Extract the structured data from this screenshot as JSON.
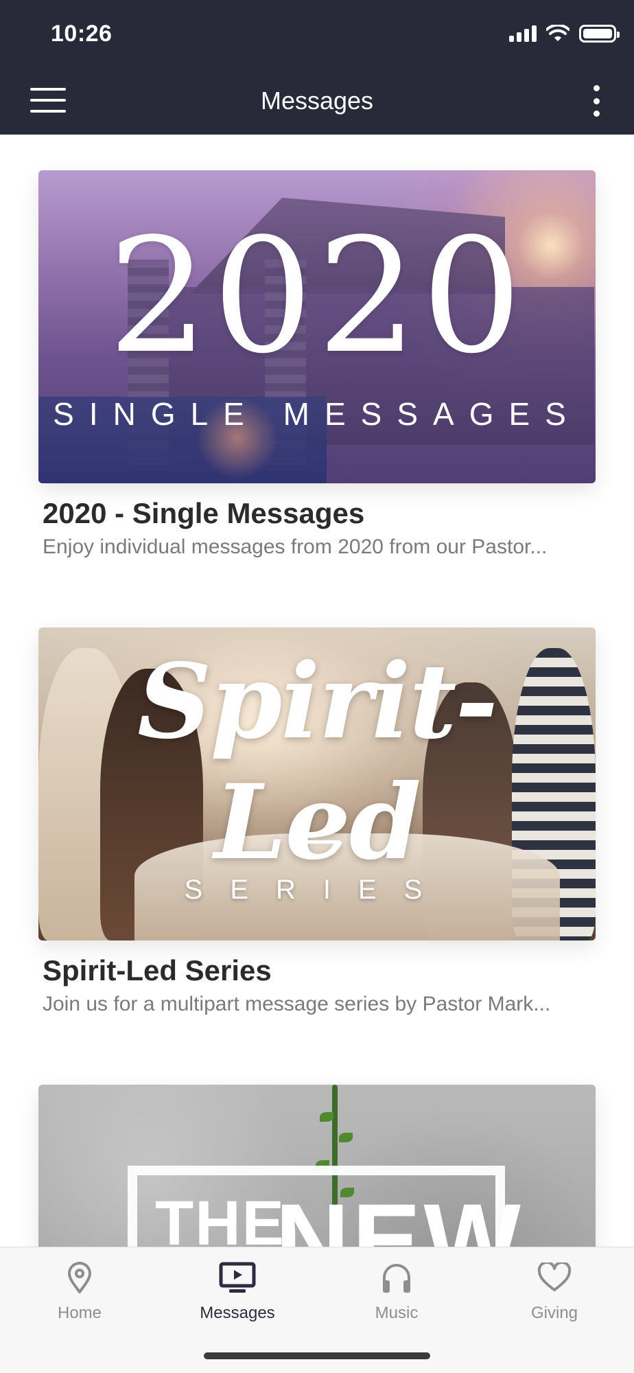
{
  "status_bar": {
    "time": "10:26"
  },
  "header": {
    "title": "Messages"
  },
  "cards": [
    {
      "title": "2020 - Single Messages",
      "description": "Enjoy individual messages from 2020 from our Pastor...",
      "art_big": "2020",
      "art_sub": "SINGLE MESSAGES"
    },
    {
      "title": "Spirit-Led Series",
      "description": "Join us for a multipart message series by Pastor Mark...",
      "art_big": "Spirit-Led",
      "art_sub": "SERIES"
    },
    {
      "art_word1": "THE",
      "art_word2": "NEW"
    }
  ],
  "tabs": [
    {
      "label": "Home",
      "icon": "location-pin-icon",
      "active": false
    },
    {
      "label": "Messages",
      "icon": "tv-play-icon",
      "active": true
    },
    {
      "label": "Music",
      "icon": "headphones-icon",
      "active": false
    },
    {
      "label": "Giving",
      "icon": "heart-icon",
      "active": false
    }
  ],
  "colors": {
    "header_bg": "#282a3a",
    "active_tab": "#2b2d3f",
    "inactive_tab": "#8e8e8e"
  }
}
